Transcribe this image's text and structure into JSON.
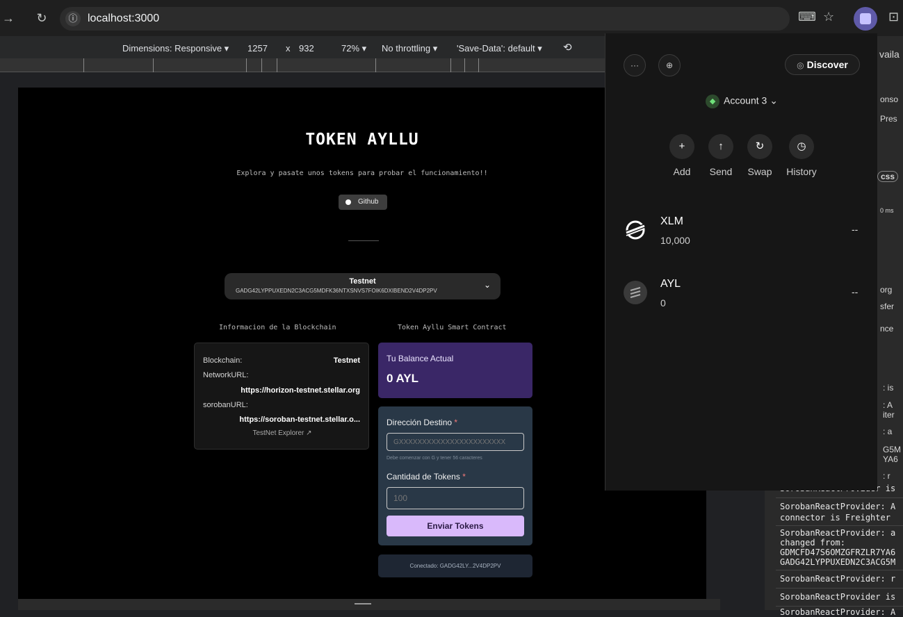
{
  "browser": {
    "url": "localhost:3000",
    "back_icon": "back-arrow-icon",
    "reload_icon": "reload-icon"
  },
  "devtools_bar": {
    "dimensions_label": "Dimensions: Responsive ▾",
    "width": "1257",
    "times": "x",
    "height": "932",
    "zoom": "72% ▾",
    "throttling": "No throttling ▾",
    "save_data": "'Save-Data': default ▾"
  },
  "app": {
    "title": "TOKEN AYLLU",
    "subtitle": "Explora y pasate unos tokens para probar el funcionamiento!!",
    "github_label": "Github",
    "network": {
      "name": "Testnet",
      "address": "GADG42LYPPUXEDN2C3ACG5MDFK36NTXSNVS7FOIK6DXIBEND2V4DP2PV"
    },
    "blockchain_section_title": "Informacion de la Blockchain",
    "contract_section_title": "Token Ayllu Smart Contract",
    "info": {
      "blockchain_label": "Blockchain:",
      "blockchain_value": "Testnet",
      "network_url_label": "NetworkURL:",
      "network_url_value": "https://horizon-testnet.stellar.org",
      "soroban_url_label": "sorobanURL:",
      "soroban_url_value": "https://soroban-testnet.stellar.o...",
      "explorer_link": "TestNet Explorer ↗"
    },
    "balance": {
      "title": "Tu Balance Actual",
      "value": "0 AYL"
    },
    "form": {
      "destination_label": "Dirección Destino",
      "required_mark": "*",
      "destination_placeholder": "GXXXXXXXXXXXXXXXXXXXXXXX",
      "destination_hint": "Debe comenzar con G y tener 56 caracteres",
      "amount_label": "Cantidad de Tokens",
      "amount_placeholder": "100",
      "submit_label": "Enviar Tokens"
    },
    "connected_text": "Conectado: GADG42LY...2V4DP2PV"
  },
  "wallet": {
    "menu_icon": "···",
    "discover_label": "Discover",
    "account_name": "Account 3",
    "actions": [
      {
        "label": "Add",
        "glyph": "+"
      },
      {
        "label": "Send",
        "glyph": "↑"
      },
      {
        "label": "Swap",
        "glyph": "↻"
      },
      {
        "label": "History",
        "glyph": "◷"
      }
    ],
    "assets": [
      {
        "code": "XLM",
        "amount": "10,000",
        "value": "--"
      },
      {
        "code": "AYL",
        "amount": "0",
        "value": "--"
      }
    ]
  },
  "console": {
    "peeks": [
      "vaila",
      "onso",
      "Pres",
      "css",
      "0 ms",
      "org",
      "sfer",
      "nce",
      ": is",
      ": A",
      "iter",
      ": a",
      "G5M",
      "YA6",
      ": r"
    ],
    "lines": [
      "SorobanReactProvider is",
      "SorobanReactProvider: A",
      "connector is  Freighter",
      "SorobanReactProvider: a",
      "changed from:",
      "GDMCFD47S6OMZGFRZLR7YA6",
      "GADG42LYPPUXEDN2C3ACG5M",
      "SorobanReactProvider: r",
      "SorobanReactProvider is",
      "SorobanReactProvider: A"
    ]
  }
}
